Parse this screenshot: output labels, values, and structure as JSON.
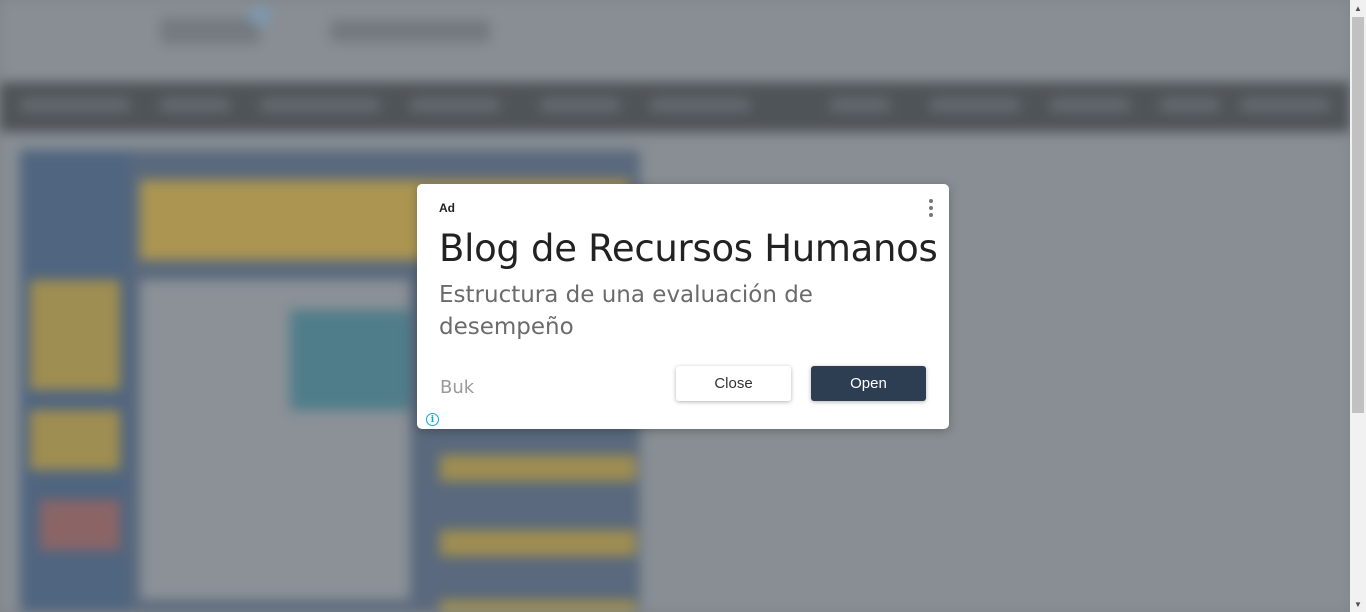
{
  "ad": {
    "label": "Ad",
    "headline": "Blog de Recursos Humanos",
    "body": "Estructura de una evaluación de desempeño",
    "advertiser": "Buk",
    "close_label": "Close",
    "open_label": "Open",
    "info_icon_glyph": "i",
    "menu_icon": "kebab-menu-icon"
  },
  "colors": {
    "open_button_bg": "#2d3e52",
    "info_icon": "#00aecd",
    "overlay": "#7f858b"
  }
}
